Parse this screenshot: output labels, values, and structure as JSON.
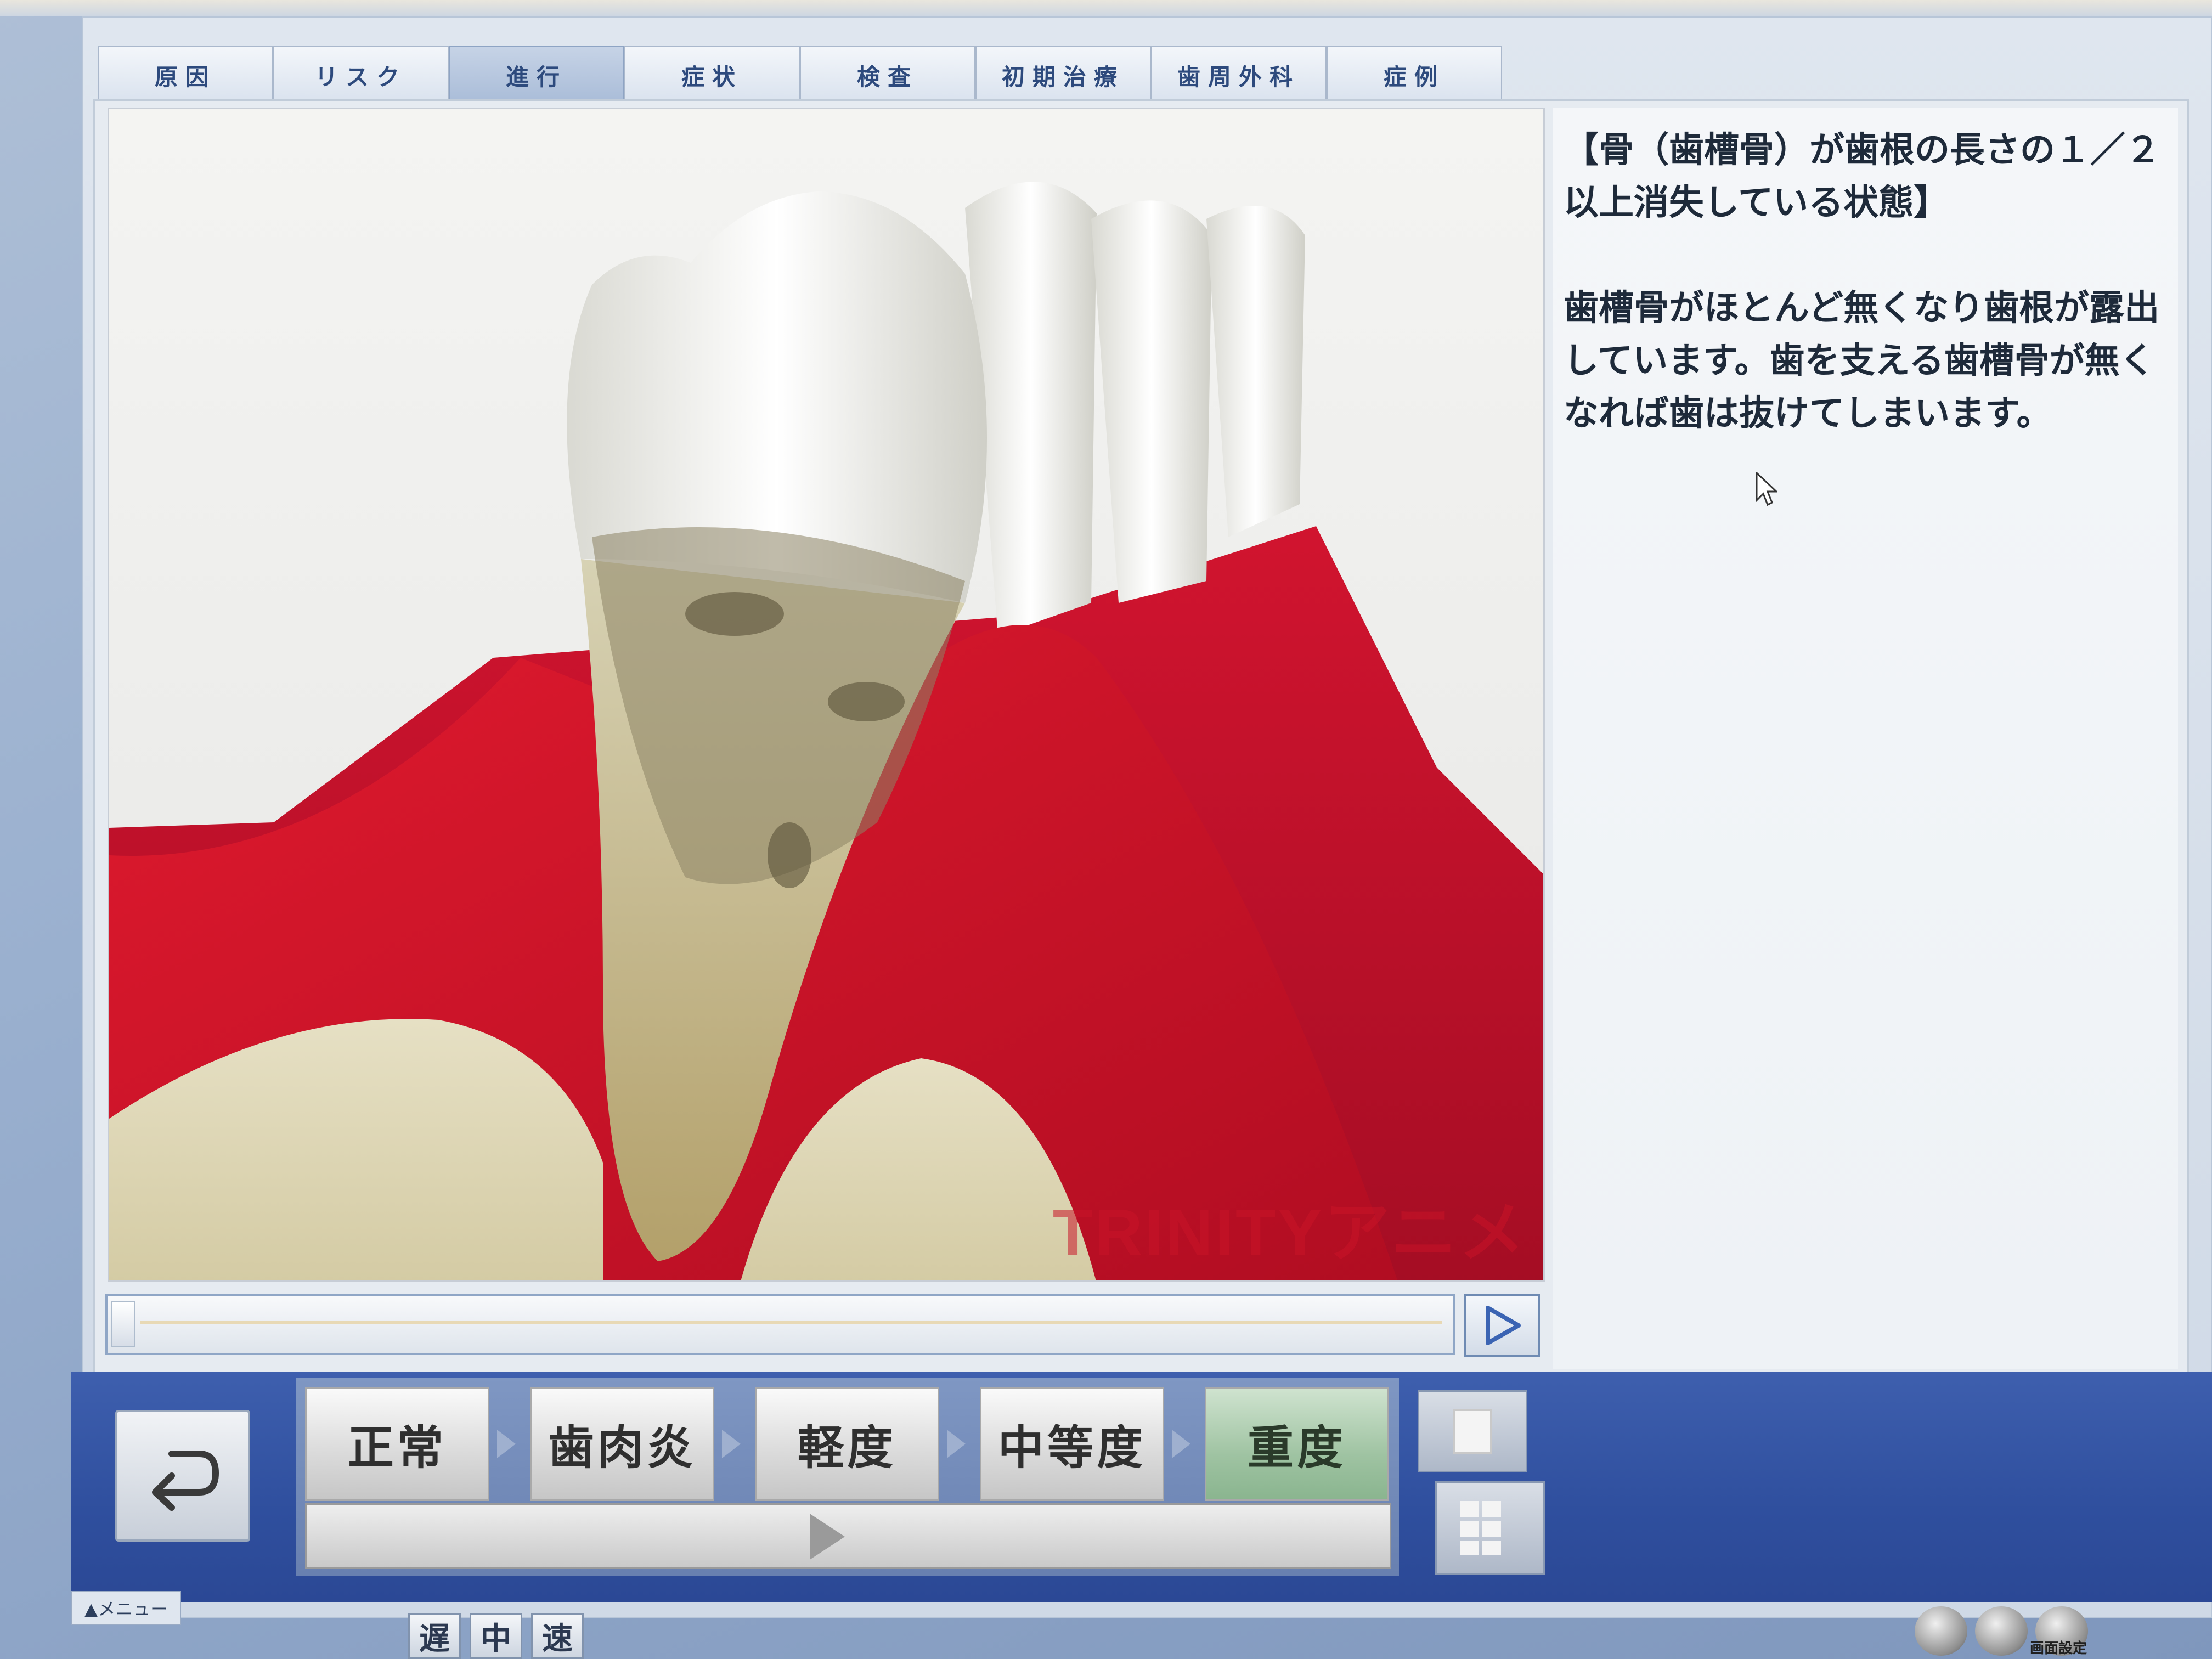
{
  "tabs": [
    {
      "label": "原因",
      "active": false
    },
    {
      "label": "リスク",
      "active": false
    },
    {
      "label": "進行",
      "active": true
    },
    {
      "label": "症状",
      "active": false
    },
    {
      "label": "検査",
      "active": false
    },
    {
      "label": "初期治療",
      "active": false
    },
    {
      "label": "歯周外科",
      "active": false
    },
    {
      "label": "症例",
      "active": false
    }
  ],
  "illustration": {
    "watermark": "TRINITYアニメ"
  },
  "description": {
    "heading": "【骨（歯槽骨）が歯根の長さの１／２以上消失している状態】",
    "body": "歯槽骨がほとんど無くなり歯根が露出しています。歯を支える歯槽骨が無くなれば歯は抜けてしまいます。"
  },
  "playback": {
    "progress": 0,
    "play_icon": "play-icon"
  },
  "stages": [
    {
      "label": "正常",
      "selected": false
    },
    {
      "label": "歯肉炎",
      "selected": false
    },
    {
      "label": "軽度",
      "selected": false
    },
    {
      "label": "中等度",
      "selected": false
    },
    {
      "label": "重度",
      "selected": true
    }
  ],
  "stage_slider": {
    "position_fraction": 0.48
  },
  "menu": {
    "label": "▲メニュー"
  },
  "speed": [
    {
      "label": "遅"
    },
    {
      "label": "中"
    },
    {
      "label": "速"
    }
  ],
  "tray": {
    "label": "画面設定"
  },
  "colors": {
    "accent": "#2f4f9e",
    "selected_stage": "#9fc3a2",
    "gum": "#c8102e"
  }
}
